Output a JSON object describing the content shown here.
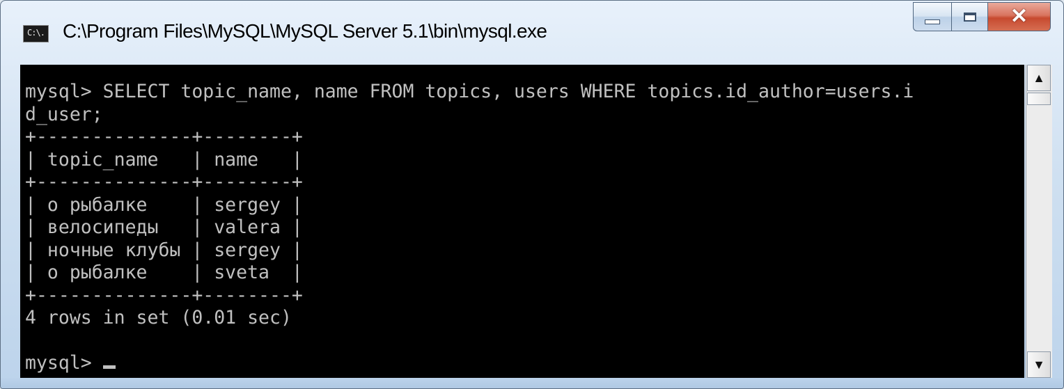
{
  "window": {
    "icon_text": "C:\\.",
    "title": "C:\\Program Files\\MySQL\\MySQL Server 5.1\\bin\\mysql.exe",
    "buttons": {
      "minimize": "minimize-icon",
      "maximize": "maximize-icon",
      "close": "close-icon"
    }
  },
  "console": {
    "query_line1": "mysql> SELECT topic_name, name FROM topics, users WHERE topics.id_author=users.i",
    "query_line2": "d_user;",
    "table": {
      "border": "+--------------+--------+",
      "header_row": "| topic_name   | name   |",
      "rows": [
        "| о рыбалке    | sergey |",
        "| велосипеды   | valera |",
        "| ночные клубы | sergey |",
        "| о рыбалке    | sveta  |"
      ]
    },
    "result_summary": "4 rows in set (0.01 sec)",
    "prompt": "mysql> "
  },
  "scrollbar": {
    "up_icon": "▲",
    "down_icon": "▼"
  },
  "colors": {
    "console_bg": "#000000",
    "console_text": "#c0c0c0"
  }
}
